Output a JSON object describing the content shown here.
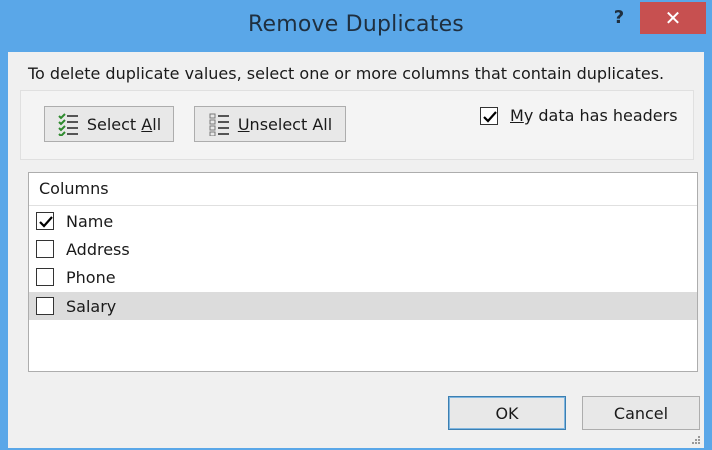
{
  "window": {
    "title": "Remove Duplicates",
    "help_label": "?",
    "close_label": "✕"
  },
  "instruction": "To delete duplicate values, select one or more columns that contain duplicates.",
  "buttons": {
    "select_all_prefix": "Select ",
    "select_all_u": "A",
    "select_all_suffix": "ll",
    "unselect_all_u": "U",
    "unselect_all_suffix": "nselect All",
    "ok": "OK",
    "cancel": "Cancel"
  },
  "headers_option": {
    "label_u": "M",
    "label_rest": "y data has headers",
    "checked": true
  },
  "columns": {
    "header": "Columns",
    "items": [
      {
        "label": "Name",
        "checked": true
      },
      {
        "label": "Address",
        "checked": false
      },
      {
        "label": "Phone",
        "checked": false
      },
      {
        "label": "Salary",
        "checked": false
      }
    ]
  },
  "colors": {
    "frame": "#5aa7e8",
    "close": "#c75050",
    "highlight_row": "#dcdcdc"
  }
}
